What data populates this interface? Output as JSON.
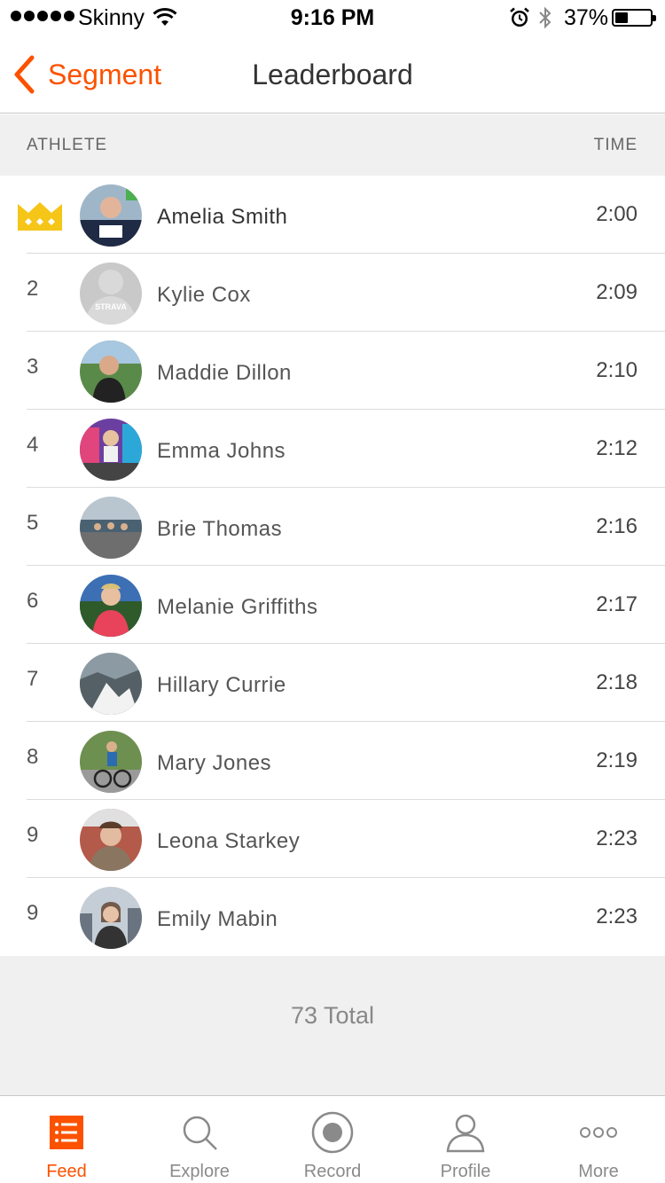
{
  "status_bar": {
    "carrier": "Skinny",
    "time": "9:16 PM",
    "battery_percent": "37%",
    "battery_level": 0.37
  },
  "nav": {
    "back_label": "Segment",
    "title": "Leaderboard"
  },
  "columns": {
    "athlete": "ATHLETE",
    "time": "TIME"
  },
  "leaderboard": [
    {
      "rank": "",
      "name": "Amelia Smith",
      "time": "2:00",
      "crown": true
    },
    {
      "rank": "2",
      "name": "Kylie Cox",
      "time": "2:09"
    },
    {
      "rank": "3",
      "name": "Maddie Dillon",
      "time": "2:10"
    },
    {
      "rank": "4",
      "name": "Emma Johns",
      "time": "2:12"
    },
    {
      "rank": "5",
      "name": "Brie Thomas",
      "time": "2:16"
    },
    {
      "rank": "6",
      "name": "Melanie Griffiths",
      "time": "2:17"
    },
    {
      "rank": "7",
      "name": "Hillary Currie",
      "time": "2:18"
    },
    {
      "rank": "8",
      "name": "Mary Jones",
      "time": "2:19"
    },
    {
      "rank": "9",
      "name": "Leona Starkey",
      "time": "2:23"
    },
    {
      "rank": "9",
      "name": "Emily Mabin",
      "time": "2:23"
    }
  ],
  "placeholder_avatar_text": "STRAVA",
  "total": "73 Total",
  "tabs": [
    {
      "label": "Feed",
      "icon": "feed-icon",
      "active": true
    },
    {
      "label": "Explore",
      "icon": "search-icon",
      "active": false
    },
    {
      "label": "Record",
      "icon": "record-icon",
      "active": false
    },
    {
      "label": "Profile",
      "icon": "profile-icon",
      "active": false
    },
    {
      "label": "More",
      "icon": "more-icon",
      "active": false
    }
  ],
  "colors": {
    "accent": "#fc5200",
    "crown": "#f5c518",
    "header_bg": "#f0f0f0"
  }
}
